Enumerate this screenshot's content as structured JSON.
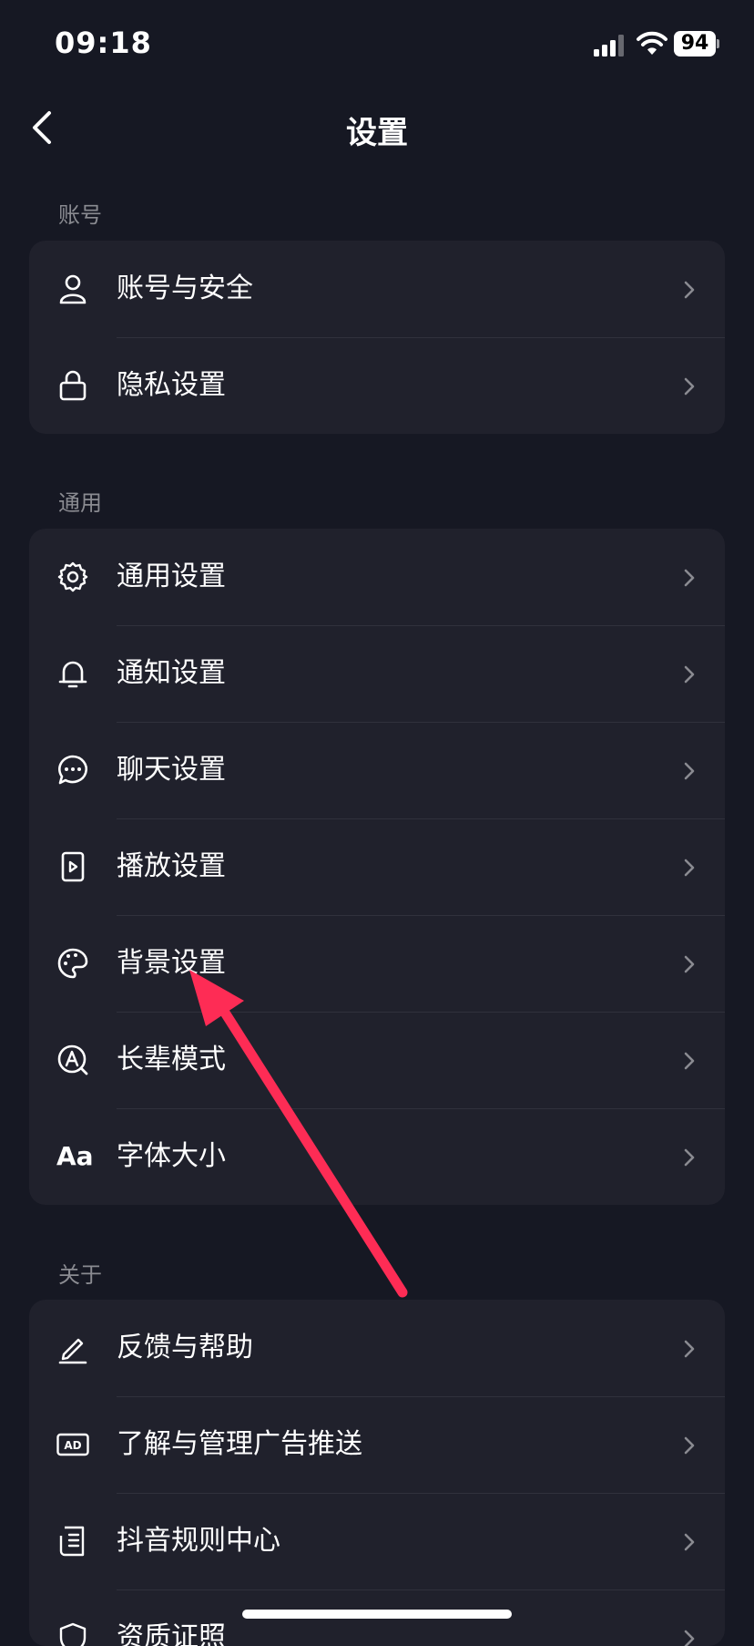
{
  "status_bar": {
    "time": "09:18",
    "battery": "94"
  },
  "nav": {
    "title": "设置"
  },
  "sections": {
    "account": {
      "label": "账号",
      "items": [
        {
          "label": "账号与安全",
          "icon": "user-icon"
        },
        {
          "label": "隐私设置",
          "icon": "lock-icon"
        }
      ]
    },
    "general": {
      "label": "通用",
      "items": [
        {
          "label": "通用设置",
          "icon": "gear-icon"
        },
        {
          "label": "通知设置",
          "icon": "bell-icon"
        },
        {
          "label": "聊天设置",
          "icon": "chat-bubble-icon"
        },
        {
          "label": "播放设置",
          "icon": "play-box-icon"
        },
        {
          "label": "背景设置",
          "icon": "palette-icon"
        },
        {
          "label": "长辈模式",
          "icon": "elder-mode-icon"
        },
        {
          "label": "字体大小",
          "icon": "font-size-icon",
          "icon_text": "Aa"
        }
      ]
    },
    "about": {
      "label": "关于",
      "items": [
        {
          "label": "反馈与帮助",
          "icon": "edit-pen-icon"
        },
        {
          "label": "了解与管理广告推送",
          "icon": "ad-icon",
          "icon_text": "AD"
        },
        {
          "label": "抖音规则中心",
          "icon": "rules-doc-icon"
        },
        {
          "label": "资质证照",
          "icon": "shield-icon"
        }
      ]
    }
  },
  "colors": {
    "background": "#161823",
    "card": "#20212c",
    "annotation_arrow": "#fe2c55"
  }
}
